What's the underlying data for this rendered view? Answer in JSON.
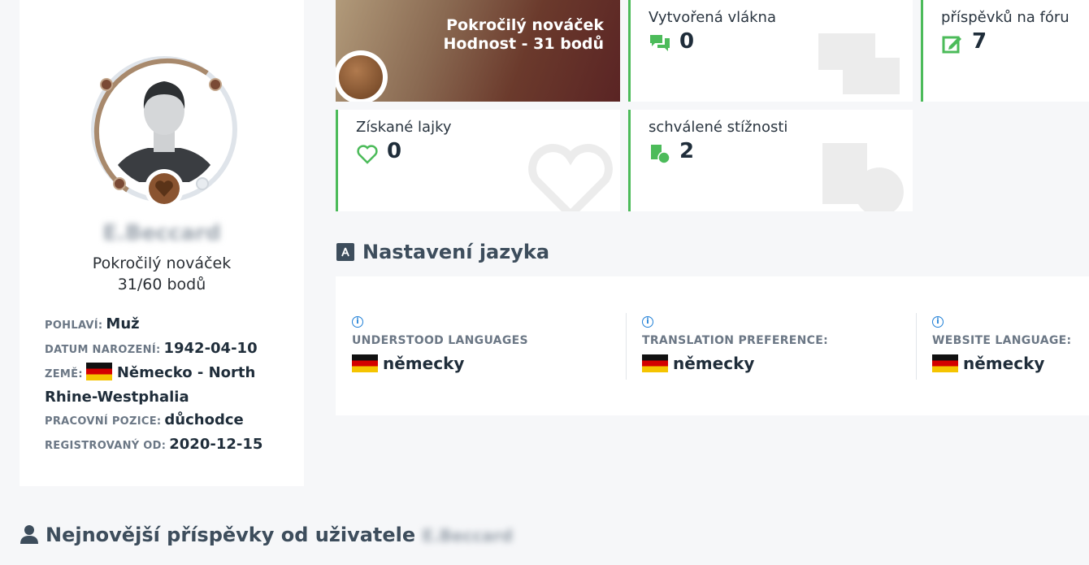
{
  "profile": {
    "username": "E.Beccard",
    "rank_name": "Pokročilý nováček",
    "points": "31/60 bodů",
    "fields": [
      {
        "label": "POHLAVÍ:",
        "value": "Muž"
      },
      {
        "label": "DATUM NAROZENÍ:",
        "value": "1942-04-10"
      },
      {
        "label": "ZEMĚ:",
        "value": "Německo - North Rhine-Westphalia"
      },
      {
        "label": "PRACOVNÍ POZICE:",
        "value": "důchodce"
      },
      {
        "label": "REGISTROVANÝ OD:",
        "value": "2020-12-15"
      }
    ],
    "progress": 0.52
  },
  "rank_card": {
    "title": "Pokročilý nováček",
    "subtitle": "Hodnost - 31 bodů"
  },
  "stats": {
    "threads": {
      "title": "Vytvořená vlákna",
      "value": "0",
      "icon": "chat-bubbles-icon"
    },
    "posts": {
      "title": "příspěvků na fóru",
      "value": "7",
      "icon": "edit-icon"
    },
    "likes": {
      "title": "Získané lajky",
      "value": "0",
      "icon": "heart-icon"
    },
    "complaints": {
      "title": "schválené stížnosti",
      "value": "2",
      "icon": "complaint-icon"
    }
  },
  "language": {
    "heading": "Nastavení jazyka",
    "columns": [
      {
        "label": "UNDERSTOOD LANGUAGES",
        "value": "německy"
      },
      {
        "label": "TRANSLATION PREFERENCE:",
        "value": "německy"
      },
      {
        "label": "WEBSITE LANGUAGE:",
        "value": "německy"
      }
    ]
  },
  "latest_posts": {
    "heading": "Nejnovější příspěvky od uživatele",
    "username": "E.Beccard"
  },
  "colors": {
    "accent_green": "#4cbb5a",
    "info_blue": "#1f7fd6"
  }
}
